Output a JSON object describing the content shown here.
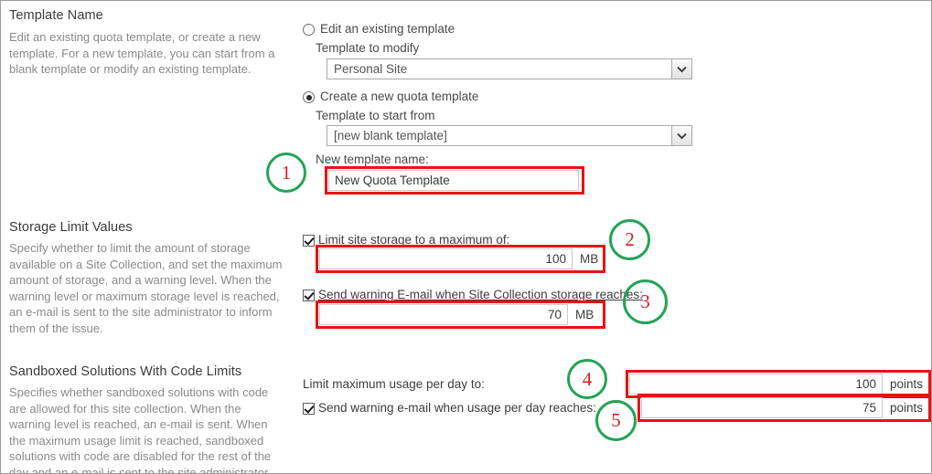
{
  "sections": [
    {
      "title": "Template Name",
      "description": "Edit an existing quota template, or create a new template. For a new template, you can start from a blank template or modify an existing template."
    },
    {
      "title": "Storage Limit Values",
      "description": "Specify whether to limit the amount of storage available on a Site Collection, and set the maximum amount of storage, and a warning level. When the warning level or maximum storage level is reached, an e-mail is sent to the site administrator to inform them of the issue."
    },
    {
      "title": "Sandboxed Solutions With Code Limits",
      "description": "Specifies whether sandboxed solutions with code are allowed for this site collection.  When the warning level is reached, an e-mail is sent.  When the maximum usage limit is reached, sandboxed solutions with code are disabled for the rest of the day and an e-mail is sent to the site administrator."
    }
  ],
  "template_name": {
    "edit_existing_radio_label": "Edit an existing template",
    "edit_existing_selected": false,
    "template_to_modify_label": "Template to modify",
    "template_to_modify_value": "Personal Site",
    "create_new_radio_label": "Create a new quota template",
    "create_new_selected": true,
    "template_to_start_from_label": "Template to start from",
    "template_to_start_from_value": "[new blank template]",
    "new_template_name_label": "New template name:",
    "new_template_name_value": "New Quota Template"
  },
  "storage_limits": {
    "limit_storage_label": "Limit site storage to a maximum of:",
    "limit_storage_checked": true,
    "limit_storage_value": "100",
    "limit_storage_unit": "MB",
    "warning_email_label": "Send warning E-mail when Site Collection storage reaches:",
    "warning_email_checked": true,
    "warning_email_value": "70",
    "warning_email_unit": "MB"
  },
  "sandboxed_limits": {
    "max_usage_label": "Limit maximum usage per day to:",
    "max_usage_value": "100",
    "max_usage_unit": "points",
    "warning_usage_label": "Send warning e-mail when usage per day reaches:",
    "warning_usage_checked": true,
    "warning_usage_value": "75",
    "warning_usage_unit": "points"
  },
  "annotations": {
    "markers": [
      "1",
      "2",
      "3",
      "4",
      "5"
    ],
    "box_color": "#e81313",
    "circle_color": "#23a455",
    "number_color": "#d61f26"
  }
}
